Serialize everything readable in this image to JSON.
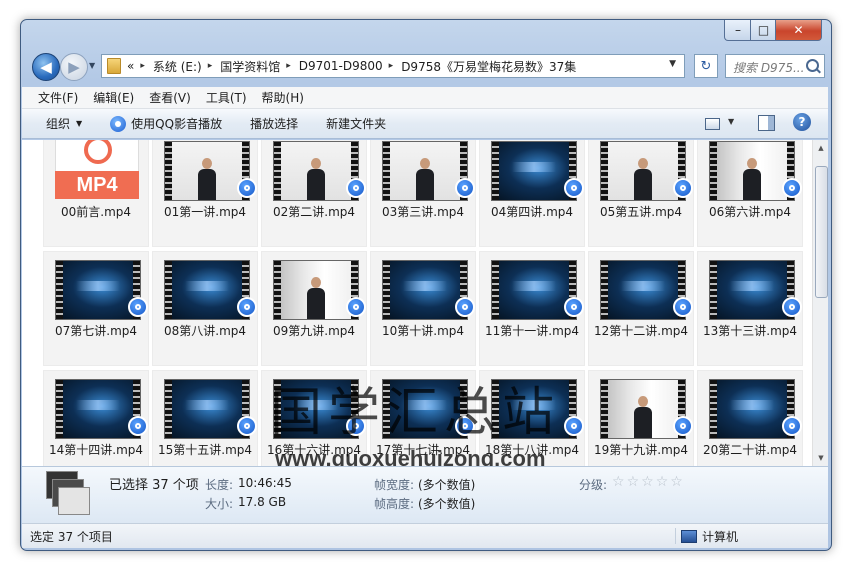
{
  "window": {
    "controls": {
      "minimize": "–",
      "maximize": "□",
      "close": "✕"
    }
  },
  "nav": {
    "back_glyph": "◀",
    "forward_glyph": "▶",
    "breadcrumb": {
      "overflow": "«",
      "items": [
        "系统 (E:)",
        "国学资料馆",
        "D9701-D9800",
        "D9758《万易堂梅花易数》37集"
      ],
      "separator": "▸"
    },
    "refresh_glyph": "↻",
    "search_placeholder": "搜索 D975..."
  },
  "menubar": [
    "文件(F)",
    "编辑(E)",
    "查看(V)",
    "工具(T)",
    "帮助(H)"
  ],
  "toolbar": {
    "organize": "组织",
    "play_qq": "使用QQ影音播放",
    "play_selection": "播放选择",
    "new_folder": "新建文件夹",
    "help": "?"
  },
  "files": [
    {
      "name": "00前言.mp4",
      "kind": "mp4icon",
      "icon_text": "MP4"
    },
    {
      "name": "01第一讲.mp4",
      "kind": "lecture"
    },
    {
      "name": "02第二讲.mp4",
      "kind": "lecture"
    },
    {
      "name": "03第三讲.mp4",
      "kind": "lecture"
    },
    {
      "name": "04第四讲.mp4",
      "kind": "blue"
    },
    {
      "name": "05第五讲.mp4",
      "kind": "lecture"
    },
    {
      "name": "06第六讲.mp4",
      "kind": "board"
    },
    {
      "name": "07第七讲.mp4",
      "kind": "blue"
    },
    {
      "name": "08第八讲.mp4",
      "kind": "blue"
    },
    {
      "name": "09第九讲.mp4",
      "kind": "board"
    },
    {
      "name": "10第十讲.mp4",
      "kind": "blue"
    },
    {
      "name": "11第十一讲.mp4",
      "kind": "blue"
    },
    {
      "name": "12第十二讲.mp4",
      "kind": "blue"
    },
    {
      "name": "13第十三讲.mp4",
      "kind": "blue"
    },
    {
      "name": "14第十四讲.mp4",
      "kind": "blue"
    },
    {
      "name": "15第十五讲.mp4",
      "kind": "blue"
    },
    {
      "name": "16第十六讲.mp4",
      "kind": "blue"
    },
    {
      "name": "17第十七讲.mp4",
      "kind": "blue"
    },
    {
      "name": "18第十八讲.mp4",
      "kind": "blue"
    },
    {
      "name": "19第十九讲.mp4",
      "kind": "board"
    },
    {
      "name": "20第二十讲.mp4",
      "kind": "blue"
    }
  ],
  "watermark": {
    "text": "国学汇总站",
    "url": "www.guoxuehuizong.com"
  },
  "details": {
    "selected": "已选择 37 个项",
    "length_label": "长度:",
    "length_value": "10:46:45",
    "size_label": "大小:",
    "size_value": "17.8 GB",
    "frame_width_label": "帧宽度:",
    "frame_width_value": "(多个数值)",
    "frame_height_label": "帧高度:",
    "frame_height_value": "(多个数值)",
    "rating_label": "分级:",
    "rating_stars": 0,
    "star_glyph": "☆"
  },
  "status": {
    "left": "选定 37 个项目",
    "right": "计算机"
  },
  "colors": {
    "accent": "#1f4f9a",
    "close": "#c9452c",
    "mp4_orange": "#f06d52",
    "qq_blue": "#1557c7"
  }
}
